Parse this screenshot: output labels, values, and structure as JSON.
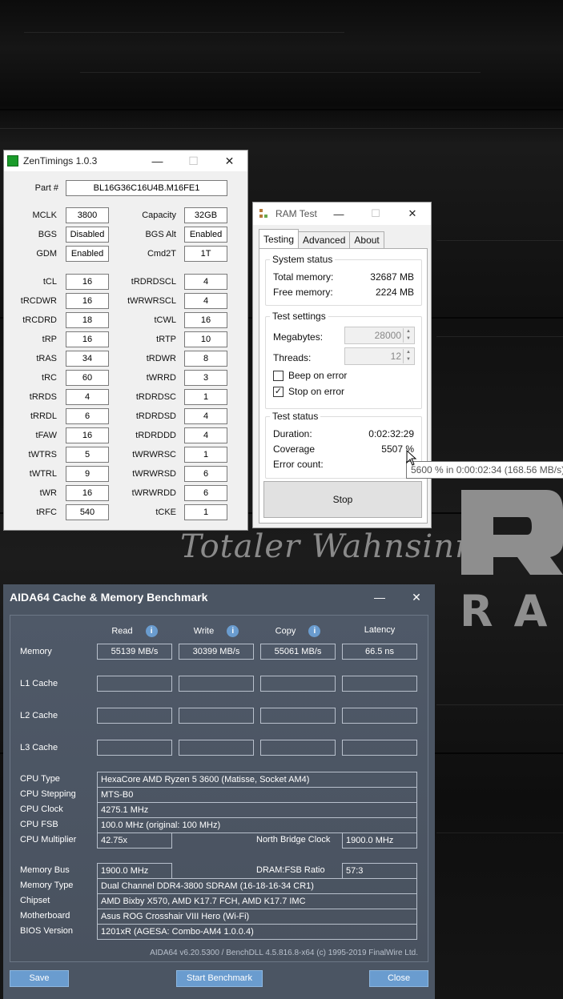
{
  "background": {
    "watermark_text": "Totaler Wahnsinn",
    "logo_letters": "RA"
  },
  "zentimings": {
    "title": "ZenTimings 1.0.3",
    "part_label": "Part #",
    "part_value": "BL16G36C16U4B.M16FE1",
    "top_rows": [
      {
        "l1": "MCLK",
        "v1": "3800",
        "l2": "Capacity",
        "v2": "32GB"
      },
      {
        "l1": "BGS",
        "v1": "Disabled",
        "l2": "BGS Alt",
        "v2": "Enabled"
      },
      {
        "l1": "GDM",
        "v1": "Enabled",
        "l2": "Cmd2T",
        "v2": "1T"
      }
    ],
    "timing_rows": [
      {
        "l1": "tCL",
        "v1": "16",
        "l2": "tRDRDSCL",
        "v2": "4"
      },
      {
        "l1": "tRCDWR",
        "v1": "16",
        "l2": "tWRWRSCL",
        "v2": "4"
      },
      {
        "l1": "tRCDRD",
        "v1": "18",
        "l2": "tCWL",
        "v2": "16"
      },
      {
        "l1": "tRP",
        "v1": "16",
        "l2": "tRTP",
        "v2": "10"
      },
      {
        "l1": "tRAS",
        "v1": "34",
        "l2": "tRDWR",
        "v2": "8"
      },
      {
        "l1": "tRC",
        "v1": "60",
        "l2": "tWRRD",
        "v2": "3"
      },
      {
        "l1": "tRRDS",
        "v1": "4",
        "l2": "tRDRDSC",
        "v2": "1"
      },
      {
        "l1": "tRRDL",
        "v1": "6",
        "l2": "tRDRDSD",
        "v2": "4"
      },
      {
        "l1": "tFAW",
        "v1": "16",
        "l2": "tRDRDDD",
        "v2": "4"
      },
      {
        "l1": "tWTRS",
        "v1": "5",
        "l2": "tWRWRSC",
        "v2": "1"
      },
      {
        "l1": "tWTRL",
        "v1": "9",
        "l2": "tWRWRSD",
        "v2": "6"
      },
      {
        "l1": "tWR",
        "v1": "16",
        "l2": "tWRWRDD",
        "v2": "6"
      },
      {
        "l1": "tRFC",
        "v1": "540",
        "l2": "tCKE",
        "v2": "1"
      }
    ]
  },
  "ramtest": {
    "title": "RAM Test",
    "tabs": [
      "Testing",
      "Advanced",
      "About"
    ],
    "system_status": {
      "title": "System status",
      "total_label": "Total memory:",
      "total_value": "32687 MB",
      "free_label": "Free memory:",
      "free_value": "2224 MB"
    },
    "test_settings": {
      "title": "Test settings",
      "megabytes_label": "Megabytes:",
      "megabytes_value": "28000",
      "threads_label": "Threads:",
      "threads_value": "12",
      "beep_label": "Beep on error",
      "beep_checked": false,
      "stop_label": "Stop on error",
      "stop_checked": true
    },
    "test_status": {
      "title": "Test status",
      "duration_label": "Duration:",
      "duration_value": "0:02:32:29",
      "coverage_label": "Coverage",
      "coverage_value": "5507 %",
      "error_label": "Error count:",
      "error_value": ""
    },
    "stop_button": "Stop",
    "tooltip": "5600 % in 0:00:02:34 (168.56 MB/s)"
  },
  "aida": {
    "title": "AIDA64 Cache & Memory Benchmark",
    "columns": [
      "Read",
      "Write",
      "Copy",
      "Latency"
    ],
    "rows": [
      {
        "label": "Memory",
        "values": [
          "55139 MB/s",
          "30399 MB/s",
          "55061 MB/s",
          "66.5 ns"
        ]
      },
      {
        "label": "L1 Cache",
        "values": [
          "",
          "",
          "",
          ""
        ]
      },
      {
        "label": "L2 Cache",
        "values": [
          "",
          "",
          "",
          ""
        ]
      },
      {
        "label": "L3 Cache",
        "values": [
          "",
          "",
          "",
          ""
        ]
      }
    ],
    "cpu_type_label": "CPU Type",
    "cpu_type": "HexaCore AMD Ryzen 5 3600  (Matisse, Socket AM4)",
    "cpu_stepping_label": "CPU Stepping",
    "cpu_stepping": "MTS-B0",
    "cpu_clock_label": "CPU Clock",
    "cpu_clock": "4275.1 MHz",
    "cpu_fsb_label": "CPU FSB",
    "cpu_fsb": "100.0 MHz  (original: 100 MHz)",
    "cpu_mult_label": "CPU Multiplier",
    "cpu_mult": "42.75x",
    "nb_clock_label": "North Bridge Clock",
    "nb_clock": "1900.0 MHz",
    "mem_bus_label": "Memory Bus",
    "mem_bus": "1900.0 MHz",
    "dram_ratio_label": "DRAM:FSB Ratio",
    "dram_ratio": "57:3",
    "mem_type_label": "Memory Type",
    "mem_type": "Dual Channel DDR4-3800 SDRAM  (16-18-16-34 CR1)",
    "chipset_label": "Chipset",
    "chipset": "AMD Bixby X570, AMD K17.7 FCH, AMD K17.7 IMC",
    "motherboard_label": "Motherboard",
    "motherboard": "Asus ROG Crosshair VIII Hero (Wi-Fi)",
    "bios_label": "BIOS Version",
    "bios": "1201xR  (AGESA: Combo-AM4 1.0.0.4)",
    "footer": "AIDA64 v6.20.5300 / BenchDLL 4.5.816.8-x64  (c) 1995-2019 FinalWire Ltd.",
    "save_button": "Save",
    "start_button": "Start Benchmark",
    "close_button": "Close"
  }
}
